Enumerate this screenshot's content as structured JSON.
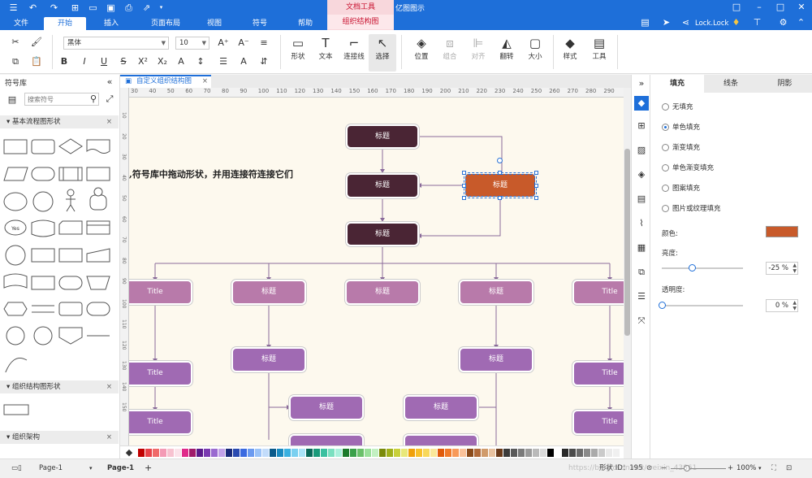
{
  "app": {
    "title": "亿图图示"
  },
  "context_tab": {
    "group": "文档工具",
    "sub": "组织结构图"
  },
  "menu": {
    "tabs": [
      "文件",
      "开始",
      "插入",
      "页面布局",
      "视图",
      "符号",
      "帮助"
    ]
  },
  "user": {
    "name": "Lock.Lock"
  },
  "ribbon": {
    "font_name": "黑体",
    "font_size": "10",
    "buttons": {
      "shape": "形状",
      "text": "文本",
      "connector": "连接线",
      "select": "选择",
      "position": "位置",
      "group": "组合",
      "align": "对齐",
      "flip": "翻转",
      "size": "大小",
      "style": "样式",
      "tools": "工具"
    }
  },
  "library": {
    "title": "符号库",
    "search_placeholder": "搜索符号",
    "sections": {
      "basic": "基本流程图形状",
      "org_shapes": "组织结构图形状",
      "org_arch": "组织架构"
    },
    "yes_label": "Yes"
  },
  "document": {
    "tab_name": "自定义组织结构图"
  },
  "canvas": {
    "hint": ",符号库中拖动形状，并用连接符连接它们",
    "nodes": {
      "title_cn": "标题",
      "title_en": "Title"
    }
  },
  "ruler": {
    "h": [
      "30",
      "40",
      "50",
      "60",
      "70",
      "80",
      "90",
      "100",
      "110",
      "120",
      "130",
      "140",
      "150",
      "160",
      "170",
      "180",
      "190",
      "200",
      "210",
      "220",
      "230",
      "240",
      "250",
      "260",
      "270",
      "280",
      "290"
    ],
    "v": [
      "10",
      "20",
      "30",
      "40",
      "50",
      "60",
      "70",
      "80",
      "90",
      "100",
      "110",
      "120",
      "130",
      "140",
      "150"
    ]
  },
  "props": {
    "tabs": [
      "填充",
      "线条",
      "阴影"
    ],
    "fill_options": [
      "无填充",
      "单色填充",
      "渐变填充",
      "单色渐变填充",
      "图案填充",
      "图片或纹理填充"
    ],
    "selected_fill": "单色填充",
    "color_label": "颜色:",
    "fill_color": "#c85a2a",
    "brightness_label": "亮度:",
    "brightness_value": "-25 %",
    "brightness": 0.37,
    "transparency_label": "透明度:",
    "transparency_value": "0 %",
    "transparency": 0.0
  },
  "status": {
    "page_nav": "Page-1",
    "page_tab": "Page-1",
    "shape_id": "形状 ID：195",
    "zoom": "100%",
    "watermark": "https://blog.csdn.net/weixin_43861"
  }
}
